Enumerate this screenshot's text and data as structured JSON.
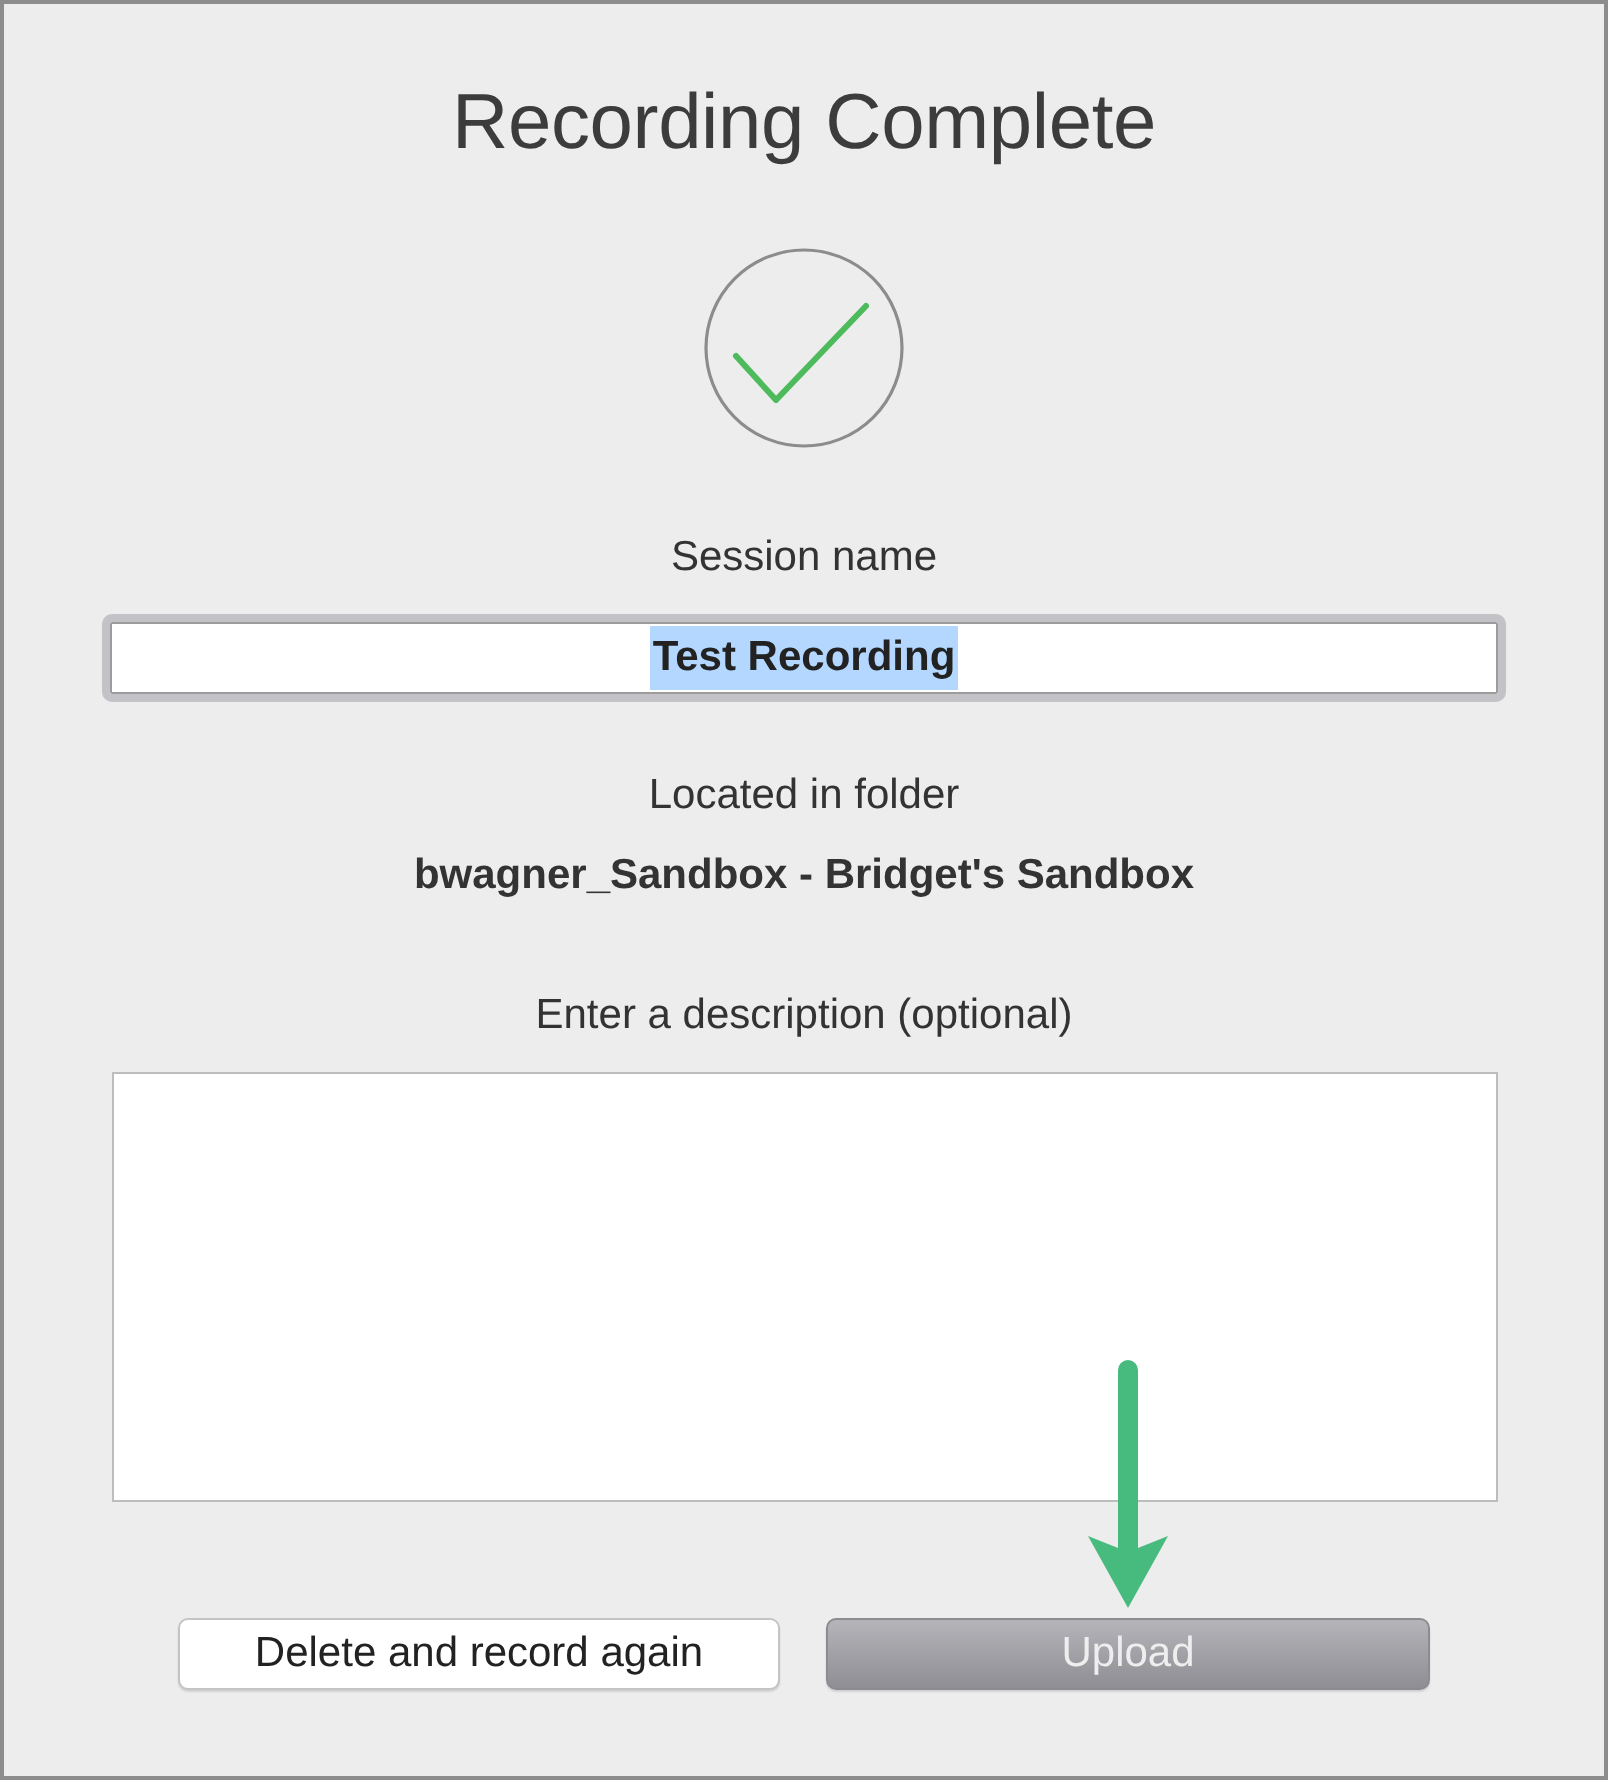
{
  "dialog": {
    "title": "Recording Complete",
    "status_icon": {
      "kind": "success"
    }
  },
  "session_name": {
    "label": "Session name",
    "value": "Test Recording",
    "text_selected": true
  },
  "folder": {
    "label": "Located in folder",
    "name": "bwagner_Sandbox - Bridget's Sandbox"
  },
  "description": {
    "label": "Enter a description (optional)"
  },
  "buttons": [
    {
      "label": "Delete and record again",
      "disabled": false
    },
    {
      "label": "Upload",
      "disabled": true
    }
  ],
  "annotation": {
    "kind": "arrow"
  }
}
